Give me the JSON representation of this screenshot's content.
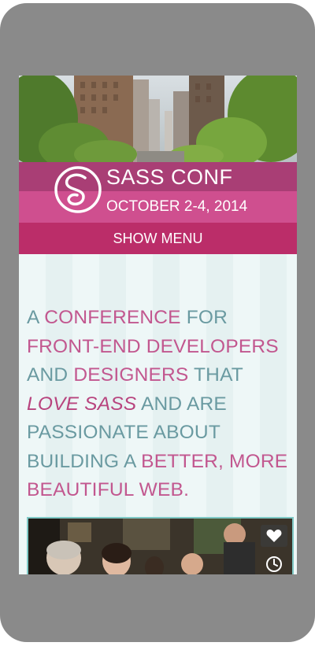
{
  "site": {
    "title": "SASS CONF",
    "dates": "OCTOBER 2-4, 2014",
    "menu_label": "SHOW MENU"
  },
  "tagline": {
    "p1": "A ",
    "p2": "CONFERENCE",
    "p3": " FOR ",
    "p4": "FRONT-END DEVELOPERS",
    "p5": " AND ",
    "p6": "DESIGNERS",
    "p7": " THAT ",
    "p8": "LOVE SASS",
    "p9": " AND ARE PASSIONATE ABOUT BUILDING A ",
    "p10": "BETTER, MORE BEAUTIFUL WEB",
    "p11": "."
  },
  "icons": {
    "logo": "sass-logo-icon",
    "favorite": "heart-icon",
    "schedule": "clock-icon"
  },
  "colors": {
    "brand_dark": "#a93e75",
    "brand_mid": "#cf4f8f",
    "menu_bar": "#bb2d69",
    "text_teal": "#6a9aa1",
    "text_pink": "#c2578f",
    "card_border": "#7fc9c6"
  }
}
